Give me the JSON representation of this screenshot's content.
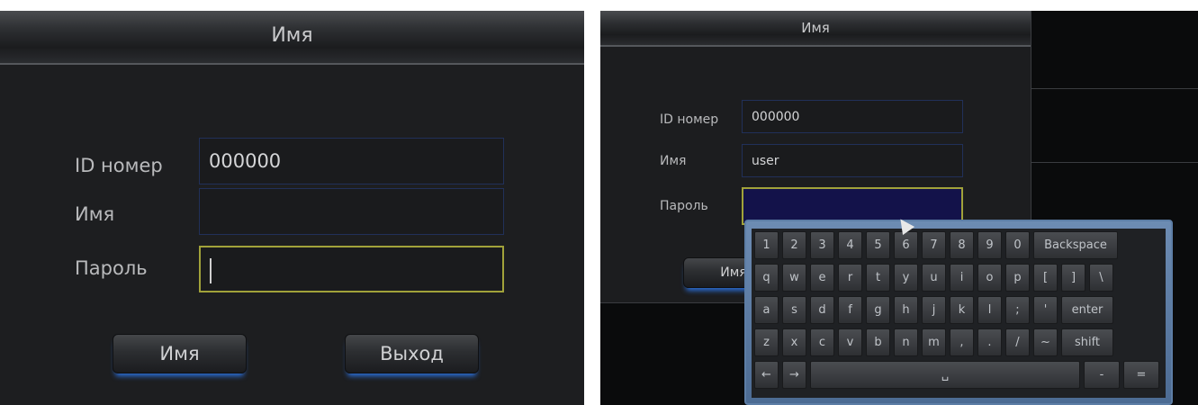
{
  "left": {
    "title": "Имя",
    "fields": [
      {
        "label": "ID номер",
        "value": "000000"
      },
      {
        "label": "Имя",
        "value": ""
      },
      {
        "label": "Пароль",
        "value": ""
      }
    ],
    "buttons": {
      "login": "Имя",
      "exit": "Выход"
    }
  },
  "right": {
    "title": "Имя",
    "fields": [
      {
        "label": "ID номер",
        "value": "000000"
      },
      {
        "label": "Имя",
        "value": "user"
      },
      {
        "label": "Пароль",
        "value": ""
      }
    ],
    "buttons": {
      "login": "Имя"
    }
  },
  "keyboard": {
    "rows": [
      [
        "1",
        "2",
        "3",
        "4",
        "5",
        "6",
        "7",
        "8",
        "9",
        "0",
        "Backspace"
      ],
      [
        "q",
        "w",
        "e",
        "r",
        "t",
        "y",
        "u",
        "i",
        "o",
        "p",
        "[",
        "]",
        "\\"
      ],
      [
        "a",
        "s",
        "d",
        "f",
        "g",
        "h",
        "j",
        "k",
        "l",
        ";",
        "'",
        "enter"
      ],
      [
        "z",
        "x",
        "c",
        "v",
        "b",
        "n",
        "m",
        ",",
        ".",
        "/",
        "~",
        "shift"
      ]
    ],
    "bottom": {
      "left": "←",
      "right": "→",
      "space": "␣",
      "dash": "-",
      "equals": "="
    }
  },
  "colors": {
    "accent": "#2c6ed6",
    "active_border": "#a1a23a"
  }
}
